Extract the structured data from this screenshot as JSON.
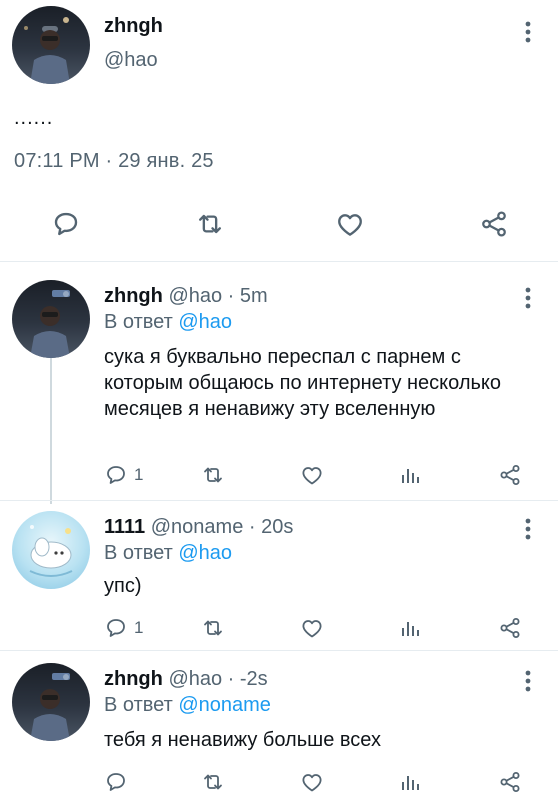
{
  "main_tweet": {
    "name": "zhngh",
    "handle": "@hao",
    "text": "......",
    "timestamp": "07:11 PM · 29 янв. 25",
    "actions": [
      "reply-icon",
      "retweet-icon",
      "like-icon",
      "share-icon"
    ]
  },
  "replies": [
    {
      "name": "zhngh",
      "meta": "@hao · 5m",
      "reply_prefix": "В ответ",
      "reply_to": "@hao",
      "text": "сука я буквально переспал с парнем с которым общаюсь по интернету несколько месяцев я ненавижу эту вселенную",
      "reply_count": "1",
      "avatar": "photo-avatar"
    },
    {
      "name": "1111",
      "meta": "@noname · 20s",
      "reply_prefix": "В ответ",
      "reply_to": "@hao",
      "text": "упс)",
      "reply_count": "1",
      "avatar": "cartoon-avatar"
    },
    {
      "name": "zhngh",
      "meta": "@hao · -2s",
      "reply_prefix": "В ответ",
      "reply_to": "@noname",
      "text": "тебя я ненавижу больше всех",
      "reply_count": "",
      "avatar": "photo-avatar"
    }
  ],
  "colors": {
    "text": "#0f1419",
    "secondary": "#536471",
    "accent": "#1d9bf0",
    "divider": "#e6ecf0"
  }
}
